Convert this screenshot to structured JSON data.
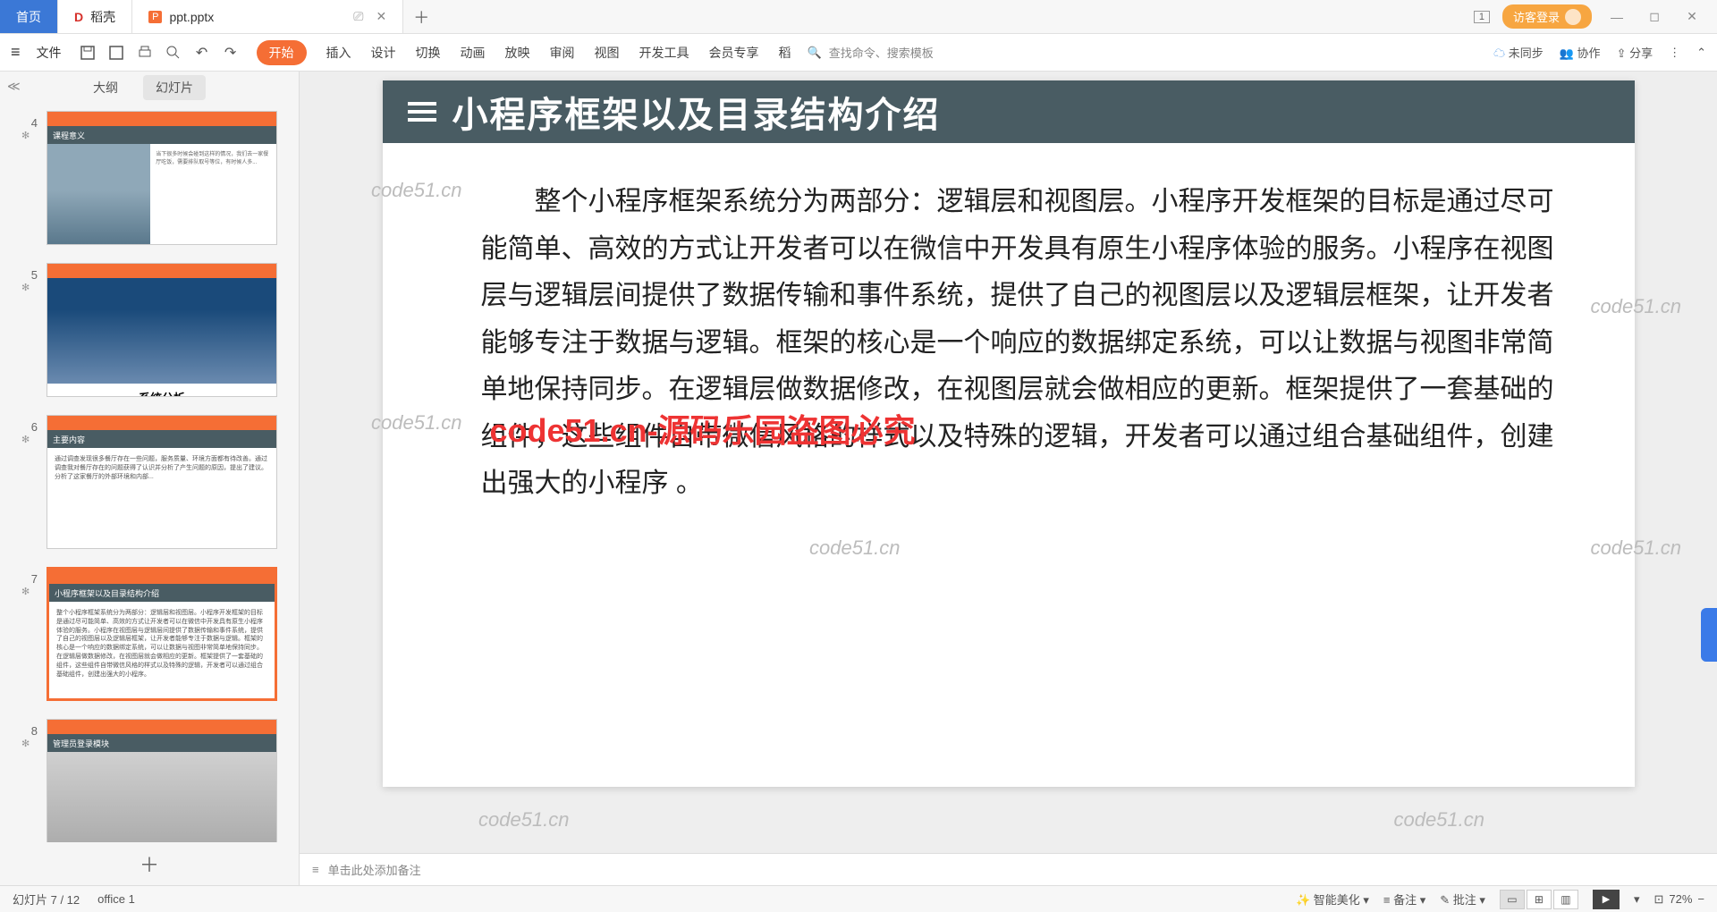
{
  "titlebar": {
    "tabs": [
      {
        "label": "首页"
      },
      {
        "label": "稻壳"
      },
      {
        "label": "ppt.pptx"
      }
    ],
    "login": "访客登录",
    "window_badge": "1"
  },
  "ribbon": {
    "file": "文件",
    "tabs": [
      "开始",
      "插入",
      "设计",
      "切换",
      "动画",
      "放映",
      "审阅",
      "视图",
      "开发工具",
      "会员专享",
      "稻"
    ],
    "search_placeholder": "查找命令、搜索模板",
    "unsync": "未同步",
    "collab": "协作",
    "share": "分享"
  },
  "sidebar": {
    "tab_outline": "大纲",
    "tab_slides": "幻灯片",
    "thumbs": [
      {
        "num": "4",
        "header": "课程意义"
      },
      {
        "num": "5",
        "caption": "系统分析"
      },
      {
        "num": "6",
        "header": "主要内容"
      },
      {
        "num": "7",
        "header": "小程序框架以及目录结构介绍"
      },
      {
        "num": "8",
        "header": "管理员登录模块"
      }
    ],
    "add": "＋"
  },
  "slide": {
    "title": "小程序框架以及目录结构介绍",
    "body": "整个小程序框架系统分为两部分：逻辑层和视图层。小程序开发框架的目标是通过尽可能简单、高效的方式让开发者可以在微信中开发具有原生小程序体验的服务。小程序在视图层与逻辑层间提供了数据传输和事件系统，提供了自己的视图层以及逻辑层框架，让开发者能够专注于数据与逻辑。框架的核心是一个响应的数据绑定系统，可以让数据与视图非常简单地保持同步。在逻辑层做数据修改，在视图层就会做相应的更新。框架提供了一套基础的组件，这些组件自带微信风格的样式以及特殊的逻辑，开发者可以通过组合基础组件，创建出强大的小程序 。",
    "watermark_center": "code51.cn-源码乐园盗图必究",
    "wm": "code51.cn"
  },
  "notes": {
    "placeholder": "单击此处添加备注"
  },
  "statusbar": {
    "slide_info": "幻灯片 7 / 12",
    "office": "office 1",
    "beautify": "智能美化",
    "notes_btn": "备注",
    "comment_btn": "批注",
    "zoom": "72%"
  }
}
